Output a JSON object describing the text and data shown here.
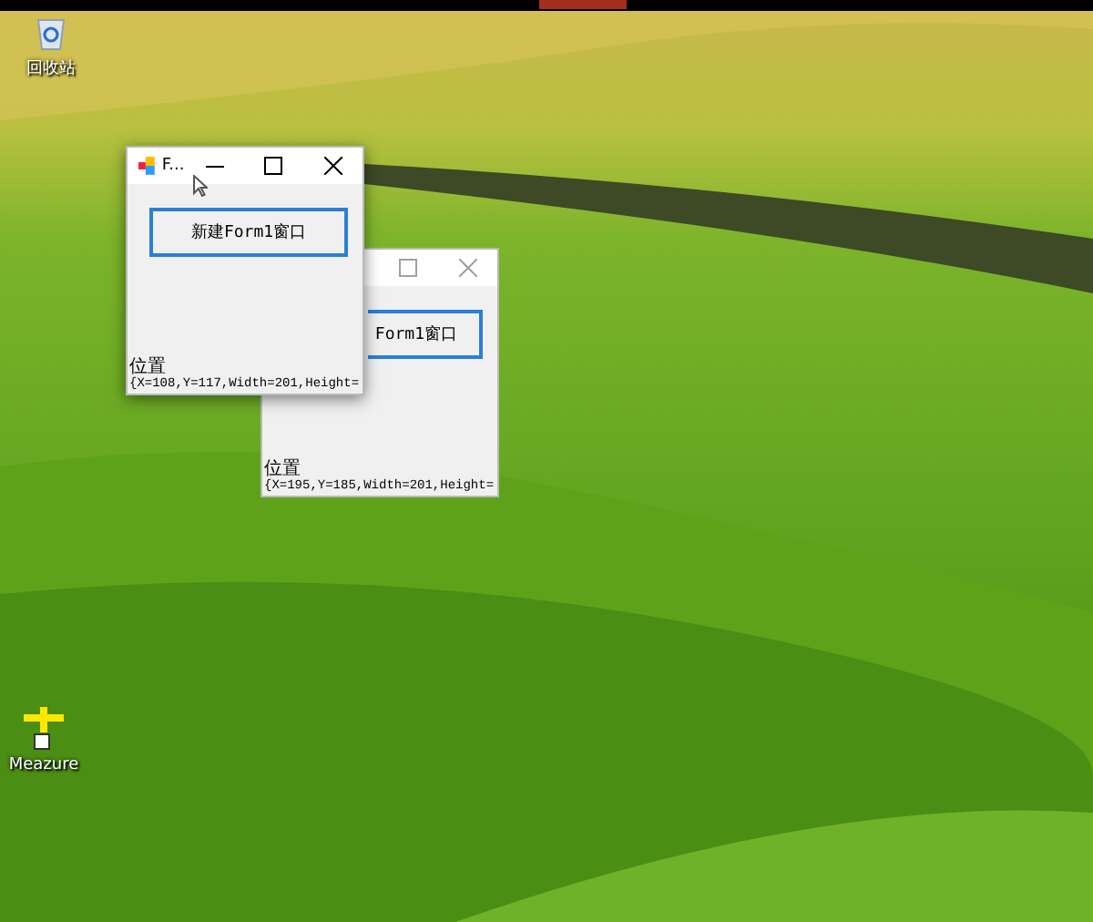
{
  "desktop_icons": [
    {
      "kind": "recycle-bin",
      "label": "回收站"
    },
    {
      "kind": "ruler",
      "label": "Meazure"
    }
  ],
  "windows": [
    {
      "active": true,
      "title": "F...",
      "button": "新建Form1窗口",
      "position_label": "位置",
      "position_value": "{X=108,Y=117,Width=201,Height="
    },
    {
      "active": false,
      "button": "Form1窗口",
      "position_label": "位置",
      "position_value": "{X=195,Y=185,Width=201,Height="
    }
  ]
}
